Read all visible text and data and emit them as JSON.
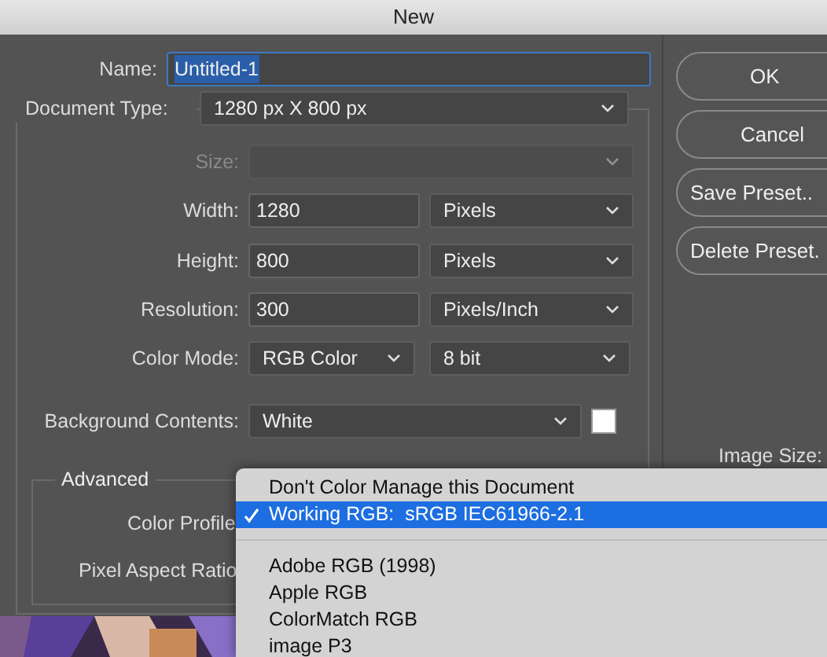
{
  "window": {
    "title": "New"
  },
  "name_field": {
    "label": "Name:",
    "value": "Untitled-1",
    "selected": true
  },
  "document_type": {
    "label": "Document Type:",
    "value": "1280 px X 800 px"
  },
  "size": {
    "label": "Size:",
    "disabled": true
  },
  "rows": [
    {
      "label": "Width:",
      "value": "1280",
      "unit": "Pixels"
    },
    {
      "label": "Height:",
      "value": "800",
      "unit": "Pixels"
    },
    {
      "label": "Resolution:",
      "value": "300",
      "unit": "Pixels/Inch"
    }
  ],
  "color_mode": {
    "label": "Color Mode:",
    "mode": "RGB Color",
    "depth": "8 bit"
  },
  "background": {
    "label": "Background Contents:",
    "value": "White",
    "color": "#ffffff"
  },
  "advanced": {
    "title": "Advanced",
    "labels": [
      "Color Profile",
      "Pixel Aspect Ratio"
    ]
  },
  "buttons": [
    "OK",
    "Cancel",
    "Save Preset..",
    "Delete Preset."
  ],
  "image_size": {
    "label": "Image Size:"
  },
  "profile_menu": [
    {
      "kind": "item",
      "label": "Don't Color Manage this Document",
      "selected": false
    },
    {
      "kind": "item",
      "label": "Working RGB:  sRGB IEC61966-2.1",
      "selected": true
    },
    {
      "kind": "separator"
    },
    {
      "kind": "item",
      "label": "Adobe RGB (1998)",
      "selected": false
    },
    {
      "kind": "item",
      "label": "Apple RGB",
      "selected": false
    },
    {
      "kind": "item",
      "label": "ColorMatch RGB",
      "selected": false
    },
    {
      "kind": "item",
      "label": "image P3",
      "selected": false
    }
  ]
}
